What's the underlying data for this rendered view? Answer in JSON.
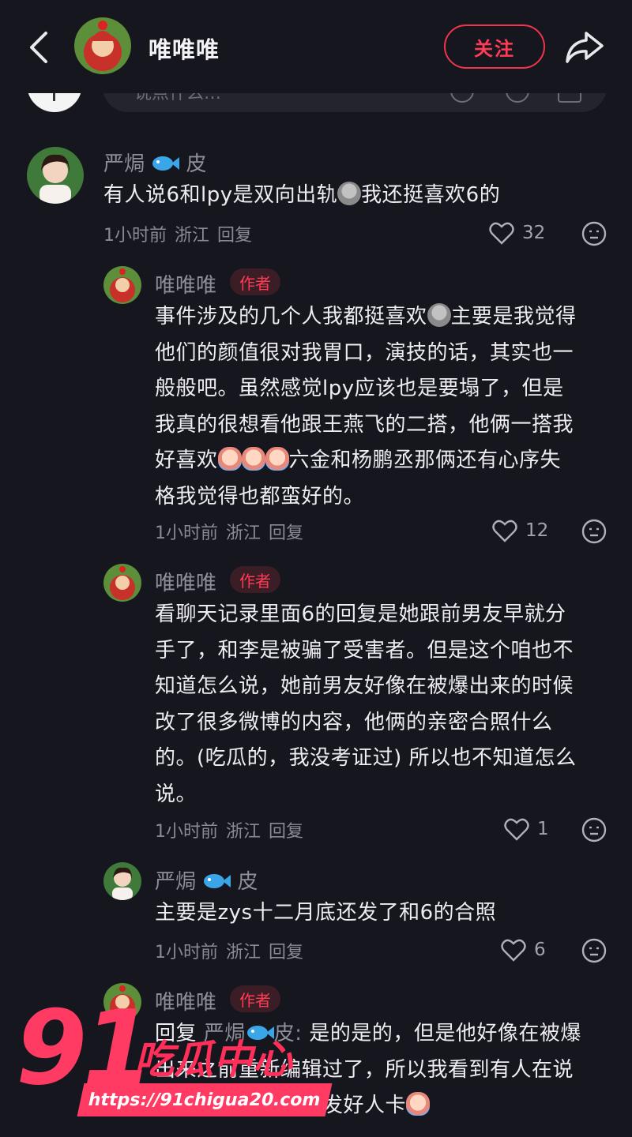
{
  "header": {
    "title": "唯唯唯",
    "follow_label": "关注"
  },
  "input_bar": {
    "placeholder": "说点什么…"
  },
  "comments": [
    {
      "user": "严焗",
      "user_suffix": "皮",
      "lines": [
        "有人说6和lpy是双向出轨",
        "我还挺喜欢6的"
      ],
      "time": "1小时前",
      "location": "浙江",
      "reply_label": "回复",
      "likes": "32"
    },
    {
      "user": "唯唯唯",
      "badge": "作者",
      "lines": [
        "事件涉及的几个人我都挺喜欢",
        "主要是我觉得",
        "他们的颜值很对我胃口，演技的话，其实也一",
        "般般吧。虽然感觉lpy应该也是要塌了，但是",
        "我真的很想看他跟王燕飞的二搭，他俩一搭我",
        "好喜欢",
        "六金和杨鹏丞那俩还有心序失",
        "格我觉得也都蛮好的。"
      ],
      "time": "1小时前",
      "location": "浙江",
      "reply_label": "回复",
      "likes": "12"
    },
    {
      "user": "唯唯唯",
      "badge": "作者",
      "lines": [
        "看聊天记录里面6的回复是她跟前男友早就分",
        "手了，和李是被骗了受害者。但是这个咱也不",
        "知道怎么说，她前男友好像在被爆出来的时候",
        "改了很多微博的内容，他俩的亲密合照什么",
        "的。(吃瓜的，我没考证过) 所以也不知道怎么",
        "说。"
      ],
      "time": "1小时前",
      "location": "浙江",
      "reply_label": "回复",
      "likes": "1"
    },
    {
      "user": "严焗",
      "user_suffix": "皮",
      "lines": [
        "主要是zys十二月底还发了和6的合照"
      ],
      "time": "1小时前",
      "location": "浙江",
      "reply_label": "回复",
      "likes": "6"
    },
    {
      "user": "唯唯唯",
      "badge": "作者",
      "reply_prefix": "回复",
      "reply_to": "严焗",
      "reply_to_suffix": "皮:",
      "lines": [
        "是的是的，但是他好像在被爆",
        "出来之前重新编辑过了，所以我看到有人在说",
        "他是好男人，给他发好人卡"
      ]
    }
  ],
  "watermark": {
    "number": "91",
    "text": "吃瓜中心",
    "url": "https://91chigua20.com"
  },
  "colors": {
    "background": "#16161e",
    "accent": "#ff3b55",
    "muted_text": "#8f8f99"
  },
  "icons": [
    "back-icon",
    "share-icon",
    "heart-icon",
    "emoji-icon",
    "fish-emoji",
    "smoke-emoji",
    "crying-emoji"
  ]
}
